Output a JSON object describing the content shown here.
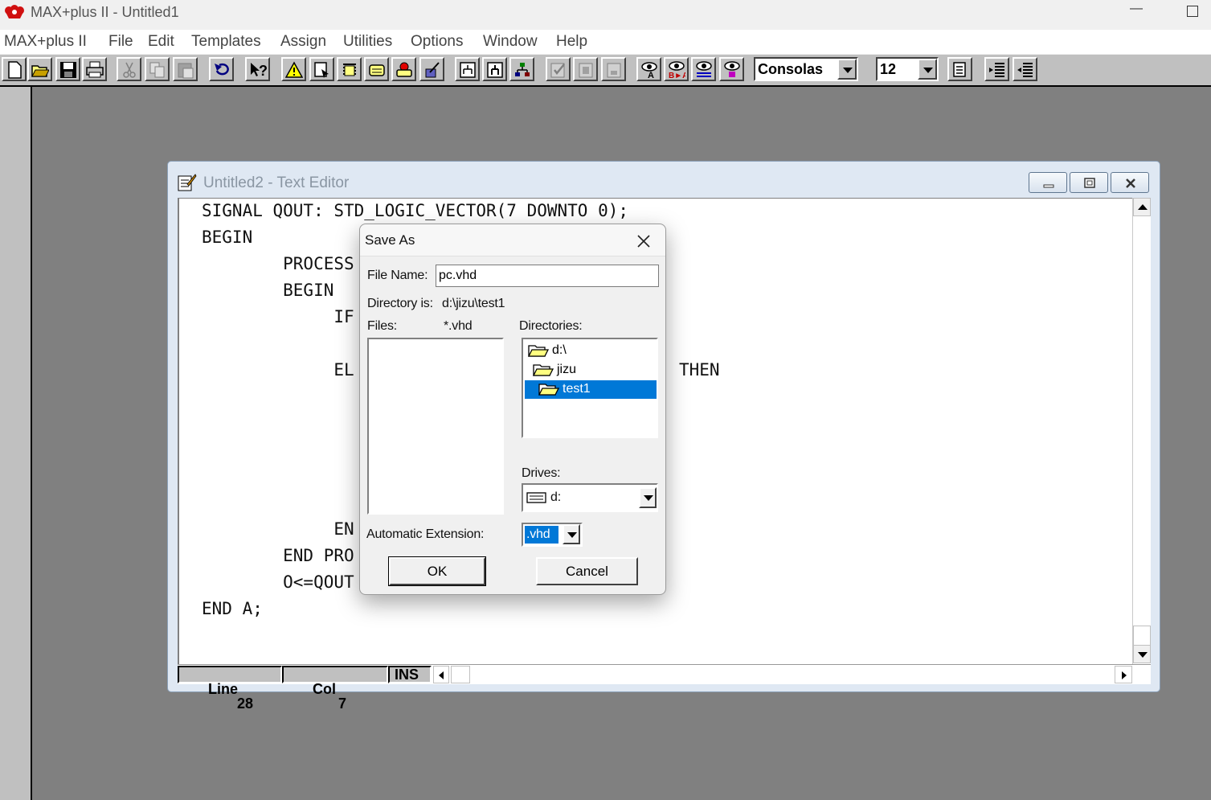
{
  "app": {
    "title": "MAX+plus II - Untitled1",
    "logo_icon": "maxplus-logo-icon",
    "controls": {
      "minimize": "—",
      "maximize": "maximize-icon"
    }
  },
  "menu": [
    "MAX+plus II",
    "File",
    "Edit",
    "Templates",
    "Assign",
    "Utilities",
    "Options",
    "Window",
    "Help"
  ],
  "toolbar": {
    "buttons": [
      "new-file-icon",
      "open-file-icon",
      "save-icon",
      "print-icon",
      "cut-icon",
      "copy-icon",
      "paste-icon",
      "undo-icon",
      "context-help-icon",
      "compile-warning-icon",
      "editor-1-icon",
      "editor-2-icon",
      "editor-3-icon",
      "editor-4-icon",
      "editor-5-icon",
      "hierarchy-1-icon",
      "hierarchy-2-icon",
      "hierarchy-3-icon",
      "check-icon",
      "gray-1-icon",
      "gray-2-icon",
      "find-icon",
      "find-replace-icon",
      "find-next-icon",
      "find-matching-icon",
      "font-style-icon",
      "indent-icon",
      "outdent-icon"
    ],
    "font_name": "Consolas",
    "font_size": "12"
  },
  "editor": {
    "title": "Untitled2 - Text Editor",
    "code_lines": [
      "SIGNAL QOUT: STD_LOGIC_VECTOR(7 DOWNTO 0);",
      "BEGIN",
      "        PROCESS",
      "        BEGIN",
      "             IF",
      "             EL",
      "THEN",
      "             EN",
      "        END PRO",
      "        O<=QOUT",
      "END A;"
    ],
    "status": {
      "line_label": "Line",
      "line_value": "28",
      "col_label": "Col",
      "col_value": "7",
      "mode": "INS"
    }
  },
  "dialog": {
    "title": "Save As",
    "file_name_label": "File Name:",
    "file_name_value": "pc.vhd",
    "directory_label": "Directory is:",
    "directory_value": "d:\\jizu\\test1",
    "files_label": "Files:",
    "files_filter": "*.vhd",
    "directories_label": "Directories:",
    "directories": [
      "d:\\",
      "jizu",
      "test1"
    ],
    "selected_directory": "test1",
    "drives_label": "Drives:",
    "drive_value": "d:",
    "auto_ext_label": "Automatic Extension:",
    "auto_ext_value": ".vhd",
    "ok_label": "OK",
    "cancel_label": "Cancel"
  },
  "colors": {
    "toolbar_gray": "#c0c0c0",
    "workspace": "#808080",
    "selection": "#0078d7"
  }
}
